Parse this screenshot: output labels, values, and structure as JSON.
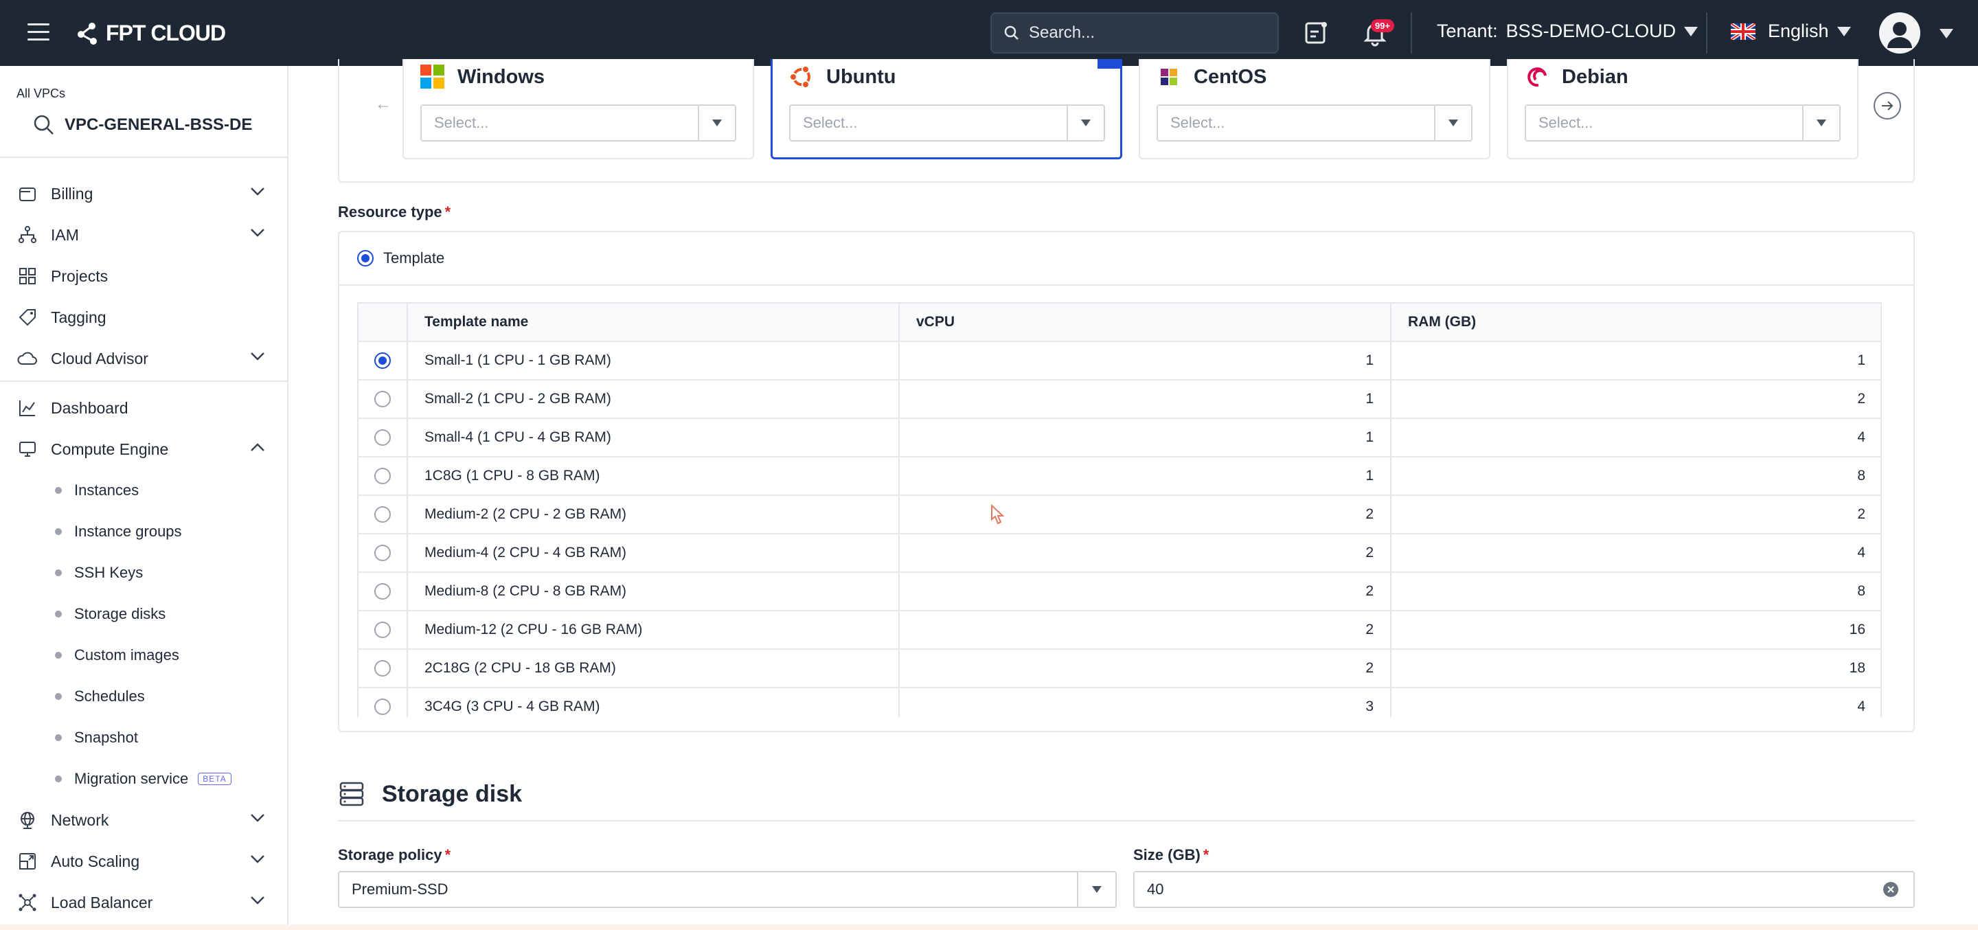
{
  "header": {
    "brand": "FPT CLOUD",
    "search_placeholder": "Search...",
    "notification_count": "99+",
    "tenant_label": "Tenant:",
    "tenant_value": "BSS-DEMO-CLOUD",
    "language": "English"
  },
  "sidebar": {
    "vpc_scope": "All VPCs",
    "vpc_name": "VPC-GENERAL-BSS-DE",
    "items": [
      {
        "label": "Billing",
        "icon": "wallet-icon",
        "expandable": true
      },
      {
        "label": "IAM",
        "icon": "hierarchy-icon",
        "expandable": true
      },
      {
        "label": "Projects",
        "icon": "grid-icon",
        "expandable": false
      },
      {
        "label": "Tagging",
        "icon": "tag-icon",
        "expandable": false
      },
      {
        "label": "Cloud Advisor",
        "icon": "cloud-icon",
        "expandable": true
      },
      {
        "label": "Dashboard",
        "icon": "chart-icon",
        "expandable": false
      },
      {
        "label": "Compute Engine",
        "icon": "monitor-icon",
        "expandable": true,
        "expanded": true
      }
    ],
    "compute_sub": [
      {
        "label": "Instances"
      },
      {
        "label": "Instance groups"
      },
      {
        "label": "SSH Keys"
      },
      {
        "label": "Storage disks"
      },
      {
        "label": "Custom images"
      },
      {
        "label": "Schedules"
      },
      {
        "label": "Snapshot"
      },
      {
        "label": "Migration service",
        "badge": "BETA"
      }
    ],
    "bottom_items": [
      {
        "label": "Network",
        "icon": "globe-icon"
      },
      {
        "label": "Auto Scaling",
        "icon": "scaling-icon"
      },
      {
        "label": "Load Balancer",
        "icon": "network-icon"
      }
    ]
  },
  "os_images": {
    "cards": [
      {
        "name": "Windows",
        "placeholder": "Select...",
        "selected": false
      },
      {
        "name": "Ubuntu",
        "placeholder": "Select...",
        "selected": true
      },
      {
        "name": "CentOS",
        "placeholder": "Select...",
        "selected": false
      },
      {
        "name": "Debian",
        "placeholder": "Select...",
        "selected": false
      }
    ]
  },
  "resource_type": {
    "label": "Resource type",
    "required_mark": "*",
    "option": "Template",
    "table": {
      "headers": [
        "Template name",
        "vCPU",
        "RAM (GB)"
      ],
      "rows": [
        {
          "name": "Small-1 (1 CPU - 1 GB RAM)",
          "vcpu": "1",
          "ram": "1",
          "selected": true
        },
        {
          "name": "Small-2 (1 CPU - 2 GB RAM)",
          "vcpu": "1",
          "ram": "2",
          "selected": false
        },
        {
          "name": "Small-4 (1 CPU - 4 GB RAM)",
          "vcpu": "1",
          "ram": "4",
          "selected": false
        },
        {
          "name": "1C8G (1 CPU - 8 GB RAM)",
          "vcpu": "1",
          "ram": "8",
          "selected": false
        },
        {
          "name": "Medium-2 (2 CPU - 2 GB RAM)",
          "vcpu": "2",
          "ram": "2",
          "selected": false
        },
        {
          "name": "Medium-4 (2 CPU - 4 GB RAM)",
          "vcpu": "2",
          "ram": "4",
          "selected": false
        },
        {
          "name": "Medium-8 (2 CPU - 8 GB RAM)",
          "vcpu": "2",
          "ram": "8",
          "selected": false
        },
        {
          "name": "Medium-12 (2 CPU - 16 GB RAM)",
          "vcpu": "2",
          "ram": "16",
          "selected": false
        },
        {
          "name": "2C18G (2 CPU - 18 GB RAM)",
          "vcpu": "2",
          "ram": "18",
          "selected": false
        },
        {
          "name": "3C4G (3 CPU - 4 GB RAM)",
          "vcpu": "3",
          "ram": "4",
          "selected": false
        }
      ]
    }
  },
  "storage": {
    "title": "Storage disk",
    "policy_label": "Storage policy",
    "policy_value": "Premium-SSD",
    "size_label": "Size (GB)",
    "size_value": "40",
    "required_mark": "*"
  },
  "colors": {
    "topbar": "#1e2835",
    "accent": "#1d4ed8",
    "required": "#dc2626"
  }
}
